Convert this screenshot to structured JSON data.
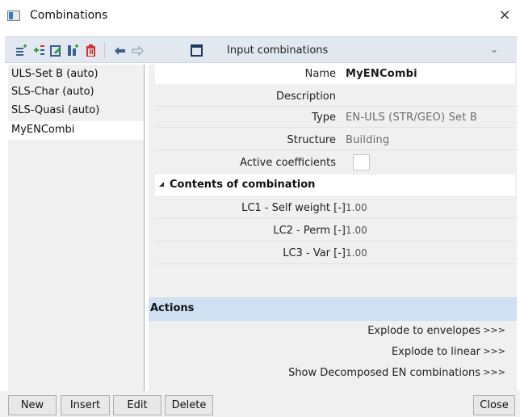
{
  "window": {
    "title": "Combinations",
    "close_glyph": "×"
  },
  "toolbar": {
    "icons": [
      "new-combination-icon",
      "insert-combination-icon",
      "edit-icon",
      "copy-icon",
      "delete-icon",
      "undo-icon",
      "redo-icon",
      "table-icon"
    ],
    "view_selector": "Input combinations",
    "view_selector_arrow": "⌄"
  },
  "combinations_list": [
    {
      "label": "ULS-Set B (auto)",
      "selected": false
    },
    {
      "label": "SLS-Char (auto)",
      "selected": false
    },
    {
      "label": "SLS-Quasi (auto)",
      "selected": false
    },
    {
      "label": "MyENCombi",
      "selected": true
    }
  ],
  "properties": {
    "name_label": "Name",
    "name_value": "MyENCombi",
    "description_label": "Description",
    "description_value": "",
    "type_label": "Type",
    "type_value": "EN-ULS (STR/GEO) Set B",
    "structure_label": "Structure",
    "structure_value": "Building",
    "active_coefficients_label": "Active coefficients",
    "active_coefficients_checked": false
  },
  "contents": {
    "title": "Contents of combination",
    "rows": [
      {
        "label": "LC1 - Self weight [-]",
        "value": "1.00"
      },
      {
        "label": "LC2 - Perm [-]",
        "value": "1.00"
      },
      {
        "label": "LC3 - Var [-]",
        "value": "1.00"
      }
    ]
  },
  "actions": {
    "title": "Actions",
    "items": [
      {
        "label": "Explode to envelopes",
        "go": ">>>"
      },
      {
        "label": "Explode to linear",
        "go": ">>>"
      },
      {
        "label": "Show Decomposed EN combinations",
        "go": ">>>"
      }
    ]
  },
  "buttons": {
    "new": "New",
    "insert": "Insert",
    "edit": "Edit",
    "delete": "Delete",
    "close": "Close"
  },
  "colors": {
    "toolbar_bg": "#e2e8ef",
    "actions_bar": "#cfe0f2",
    "accent_blue": "#3a78c8",
    "delete_red": "#d32f2f",
    "add_green": "#2e9e3a"
  }
}
